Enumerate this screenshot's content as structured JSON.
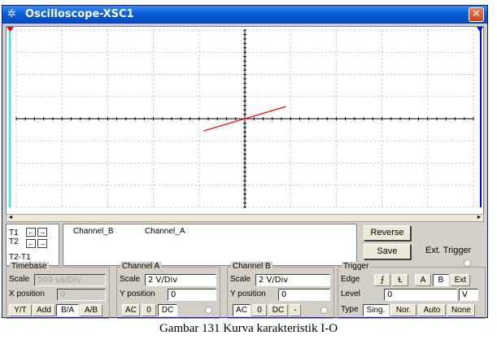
{
  "window": {
    "title": "Oscilloscope-XSC1",
    "close_symbol": "✕",
    "title_icon": "oscilloscope-icon",
    "title_icon_glyph": "✲"
  },
  "colors": {
    "trace": "#ff0000",
    "cursor1": "#00ffff",
    "cursor2": "#0000ff",
    "grid": "#c0c0c0",
    "axis": "#000000",
    "titlebar": "#0a5fd8"
  },
  "trace_segment": {
    "x_div": [
      -0.9,
      0.9
    ],
    "y_div": [
      -0.55,
      0.55
    ]
  },
  "readout": {
    "t1": "T1",
    "t2": "T2",
    "t2t1": "T2-T1",
    "left_arrow": "←",
    "right_arrow": "→",
    "columns": [
      "Channel_B",
      "Channel_A"
    ]
  },
  "buttons": {
    "reverse": "Reverse",
    "save": "Save",
    "ext_trigger": "Ext. Trigger"
  },
  "timebase": {
    "title": "Timebase",
    "scale_label": "Scale",
    "scale_value": "500 us/Div",
    "xpos_label": "X position",
    "xpos_value": "0",
    "modes": [
      "Y/T",
      "Add",
      "B/A",
      "A/B"
    ],
    "active_mode": "B/A"
  },
  "channel_a": {
    "title": "Channel A",
    "scale_label": "Scale",
    "scale_value": "2  V/Div",
    "ypos_label": "Y position",
    "ypos_value": "0",
    "coupling": [
      "AC",
      "0",
      "DC"
    ],
    "active_coupling": "DC"
  },
  "channel_b": {
    "title": "Channel B",
    "scale_label": "Scale",
    "scale_value": "2  V/Div",
    "ypos_label": "Y position",
    "ypos_value": "0",
    "coupling": [
      "AC",
      "0",
      "DC",
      "-"
    ],
    "active_coupling": "AC"
  },
  "trigger": {
    "title": "Trigger",
    "edge_label": "Edge",
    "edge_rising": "⨍",
    "edge_falling": "Ɫ",
    "sources": [
      "A",
      "B",
      "Ext"
    ],
    "active_source": "B",
    "level_label": "Level",
    "level_value": "0",
    "level_unit": "V",
    "type_label": "Type",
    "types": [
      "Sing.",
      "Nor.",
      "Auto",
      "None"
    ],
    "active_type": "Sing."
  },
  "caption": "Gambar 131 Kurva karakteristik I-O"
}
